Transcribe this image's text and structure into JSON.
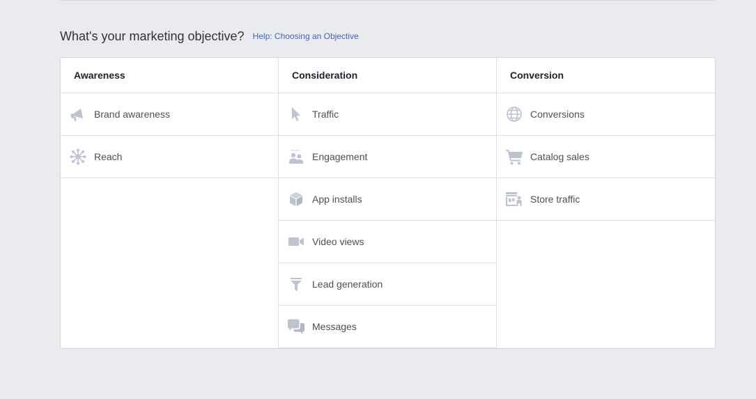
{
  "header": {
    "title": "What's your marketing objective?",
    "help_link": "Help: Choosing an Objective"
  },
  "colors": {
    "icon": "#bec3d0",
    "link": "#4267b2",
    "background": "#e9ebee"
  },
  "columns": [
    {
      "title": "Awareness",
      "items": [
        {
          "label": "Brand awareness",
          "icon": "megaphone-icon"
        },
        {
          "label": "Reach",
          "icon": "reach-icon"
        }
      ]
    },
    {
      "title": "Consideration",
      "items": [
        {
          "label": "Traffic",
          "icon": "cursor-icon"
        },
        {
          "label": "Engagement",
          "icon": "people-icon"
        },
        {
          "label": "App installs",
          "icon": "box-icon"
        },
        {
          "label": "Video views",
          "icon": "video-camera-icon"
        },
        {
          "label": "Lead generation",
          "icon": "funnel-icon"
        },
        {
          "label": "Messages",
          "icon": "chat-bubbles-icon"
        }
      ]
    },
    {
      "title": "Conversion",
      "items": [
        {
          "label": "Conversions",
          "icon": "globe-icon"
        },
        {
          "label": "Catalog sales",
          "icon": "shopping-cart-icon"
        },
        {
          "label": "Store traffic",
          "icon": "store-icon"
        }
      ]
    }
  ]
}
